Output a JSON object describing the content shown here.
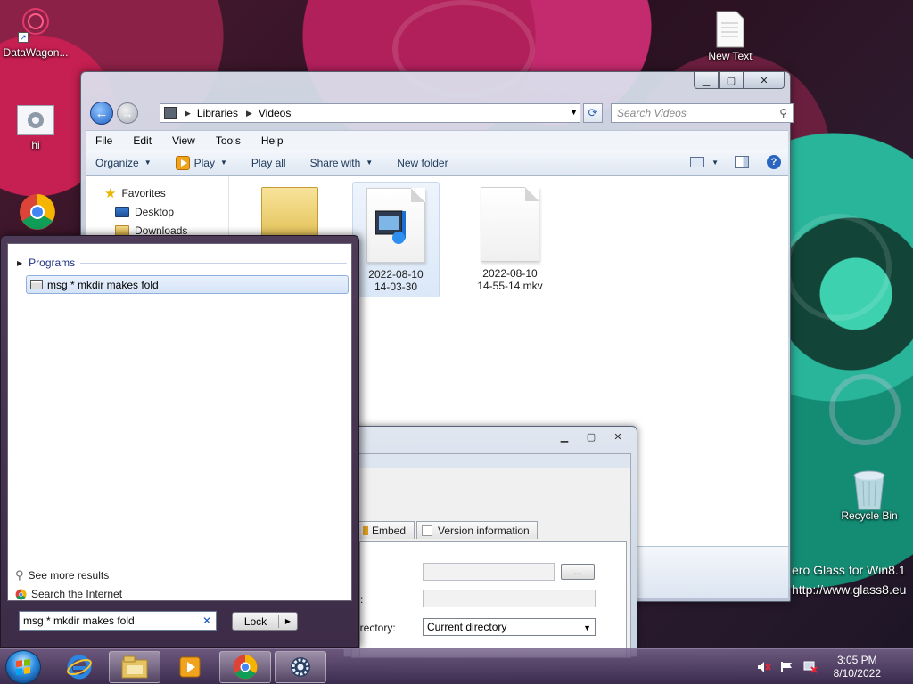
{
  "desktop": {
    "icons": [
      {
        "label": "DataWagon..."
      },
      {
        "label": "hi"
      },
      {
        "label": "New Text"
      },
      {
        "label": "Recycle Bin"
      }
    ],
    "watermark_line1": "ero Glass for Win8.1",
    "watermark_line2": "http://www.glass8.eu"
  },
  "explorer": {
    "breadcrumb": [
      "Libraries",
      "Videos"
    ],
    "search_placeholder": "Search Videos",
    "menu": [
      "File",
      "Edit",
      "View",
      "Tools",
      "Help"
    ],
    "commands": {
      "organize": "Organize",
      "play": "Play",
      "play_all": "Play all",
      "share_with": "Share with",
      "new_folder": "New folder"
    },
    "nav_pane": {
      "favorites": "Favorites",
      "desktop": "Desktop",
      "downloads": "Downloads"
    },
    "files": [
      {
        "name_line1": "2022-08-10",
        "name_line2": "14-03-30",
        "kind": "video-icon"
      },
      {
        "name_line1": "2022-08-10",
        "name_line2": "14-55-14.mkv",
        "kind": "document-icon"
      }
    ]
  },
  "properties_dialog": {
    "tabs": [
      "Embed",
      "Version information"
    ],
    "directory_label": "irectory:",
    "colon_label": ":",
    "browse_button": "...",
    "directory_value": "Current directory"
  },
  "start_menu": {
    "section_header": "Programs",
    "result_item": "msg * mkdir makes fold",
    "see_more": "See more results",
    "search_internet": "Search the Internet",
    "search_value": "msg * mkdir makes fold",
    "lock_button": "Lock"
  },
  "taskbar": {
    "apps": [
      "internet-explorer-icon",
      "file-explorer-icon",
      "media-player-icon",
      "chrome-icon",
      "settings-gear-icon"
    ],
    "time": "3:05 PM",
    "date": "8/10/2022"
  },
  "colors": {
    "accent_blue": "#1e395b",
    "selection": "#d5e3f7",
    "start_menu_bg": "#4e3b57"
  }
}
